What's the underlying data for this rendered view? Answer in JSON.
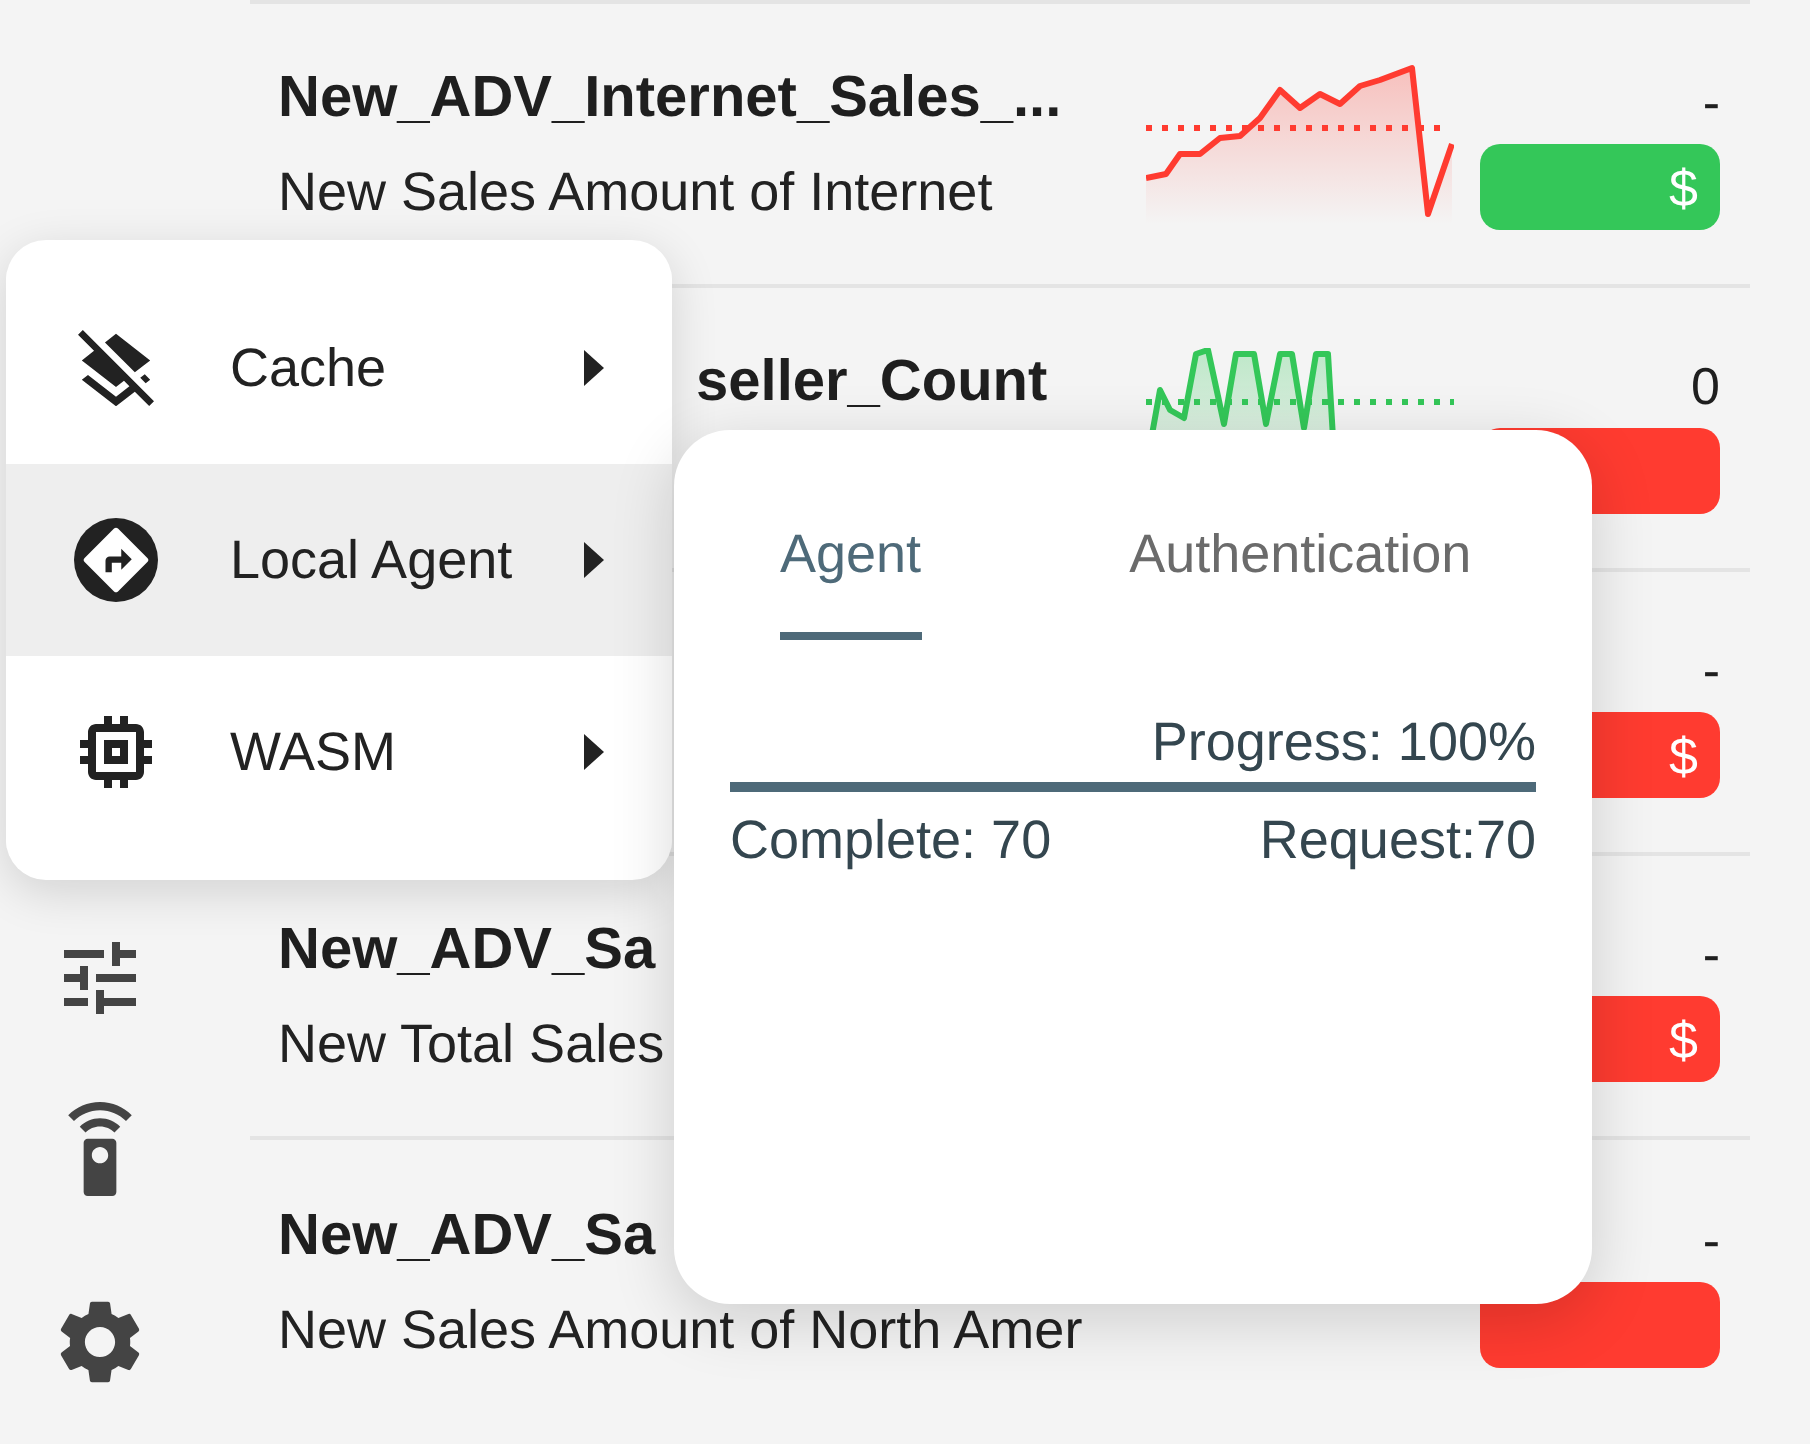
{
  "menu": {
    "items": [
      {
        "label": "Cache",
        "selected": false
      },
      {
        "label": "Local Agent",
        "selected": true
      },
      {
        "label": "WASM",
        "selected": false
      }
    ]
  },
  "list": {
    "rows": [
      {
        "kind": "standard",
        "title": "New_ADV_Internet_Sales_...",
        "subtitle": "New Sales Amount of Internet",
        "sparkline": {
          "color": "#ff3b30"
        },
        "value": "-",
        "badge": {
          "color": "#34c759",
          "symbol": "$"
        }
      },
      {
        "kind": "tail",
        "title": "seller_Count",
        "sparkline": {
          "color": "#34c759"
        },
        "value": "0",
        "badge": {
          "color": "#ff3b30"
        }
      },
      {
        "kind": "standard",
        "value": "-",
        "badge": {
          "color": "#ff3b30",
          "symbol": "$"
        }
      },
      {
        "kind": "standard",
        "title": "New_ADV_Sa",
        "subtitle": "New Total Sales",
        "value": "-",
        "badge": {
          "color": "#ff3b30",
          "symbol": "$"
        }
      },
      {
        "kind": "standard",
        "title": "New_ADV_Sa",
        "subtitle": "New Sales Amount of North Amer",
        "value": "-",
        "badge": {
          "color": "#ff3b30"
        }
      }
    ]
  },
  "popover": {
    "tabs": [
      {
        "label": "Agent",
        "selected": true
      },
      {
        "label": "Authentication",
        "selected": false
      }
    ],
    "progress": {
      "label": "Progress: 100%",
      "level": 1,
      "complete": "Complete: 70",
      "request": "Request:70"
    }
  }
}
